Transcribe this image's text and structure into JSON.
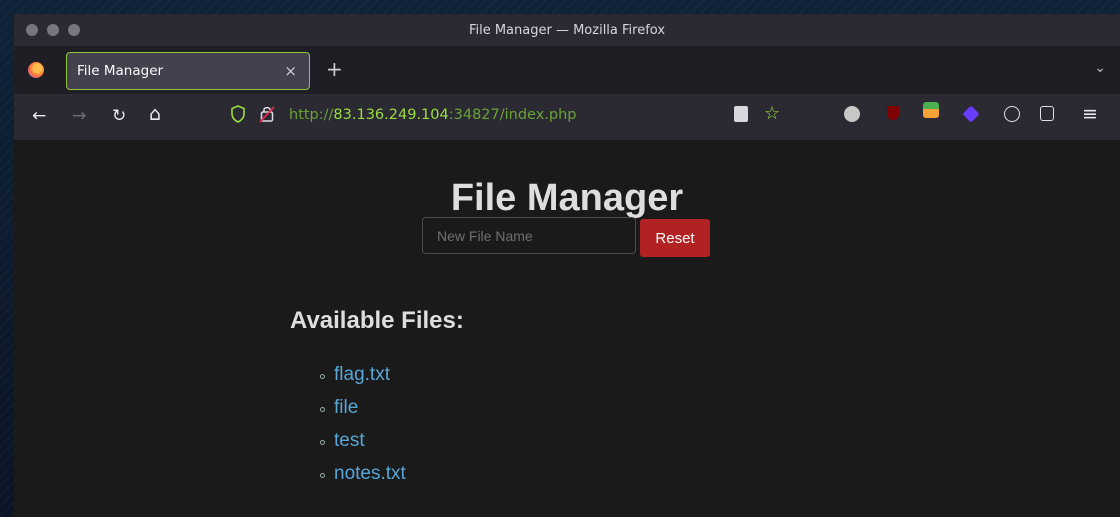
{
  "window": {
    "title": "File Manager — Mozilla Firefox"
  },
  "tab": {
    "label": "File Manager",
    "close_glyph": "×",
    "new_tab_glyph": "+"
  },
  "toolbar": {
    "back_glyph": "←",
    "forward_glyph": "→",
    "reload_glyph": "↻",
    "home_glyph": "⌂",
    "tablist_glyph": "⌄",
    "url_prefix": "http://",
    "url_host": "83.136.249.104",
    "url_rest": ":34827/index.php",
    "star_glyph": "☆",
    "menu_glyph": "≡"
  },
  "page": {
    "title": "File Manager",
    "new_file_placeholder": "New File Name",
    "reset_label": "Reset",
    "files_heading": "Available Files:",
    "files": [
      "flag.txt",
      "file",
      "test",
      "notes.txt"
    ]
  },
  "colors": {
    "accent_green": "#8fc43c",
    "reset_red": "#b22222",
    "link_blue": "#58a6d6"
  }
}
